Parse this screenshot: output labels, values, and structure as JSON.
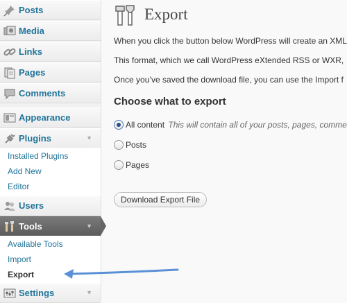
{
  "sidebar": {
    "items": [
      {
        "label": "Posts",
        "icon": "pin-icon"
      },
      {
        "label": "Media",
        "icon": "media-icon"
      },
      {
        "label": "Links",
        "icon": "link-icon"
      },
      {
        "label": "Pages",
        "icon": "pages-icon"
      },
      {
        "label": "Comments",
        "icon": "comments-icon"
      },
      {
        "label": "Appearance",
        "icon": "appearance-icon"
      },
      {
        "label": "Plugins",
        "icon": "plugins-icon",
        "toggle": "▼"
      },
      {
        "label": "Users",
        "icon": "users-icon"
      },
      {
        "label": "Tools",
        "icon": "tools-icon",
        "toggle": "▼",
        "active": true
      },
      {
        "label": "Settings",
        "icon": "settings-icon",
        "toggle": "▼"
      }
    ],
    "plugins_submenu": [
      "Installed Plugins",
      "Add New",
      "Editor"
    ],
    "tools_submenu": [
      "Available Tools",
      "Import",
      "Export"
    ]
  },
  "main": {
    "title": "Export",
    "paragraphs": [
      "When you click the button below WordPress will create an XML",
      "This format, which we call WordPress eXtended RSS or WXR,",
      "Once you’ve saved the download file, you can use the Import f"
    ],
    "section_heading": "Choose what to export",
    "options": [
      {
        "label": "All content",
        "description": "This will contain all of your posts, pages, comme",
        "checked": true
      },
      {
        "label": "Posts",
        "checked": false
      },
      {
        "label": "Pages",
        "checked": false
      }
    ],
    "download_button": "Download Export File"
  },
  "colors": {
    "link": "#21759b",
    "active_menu": "#6d6d6d",
    "annotation_arrow": "#5b8fd6"
  }
}
